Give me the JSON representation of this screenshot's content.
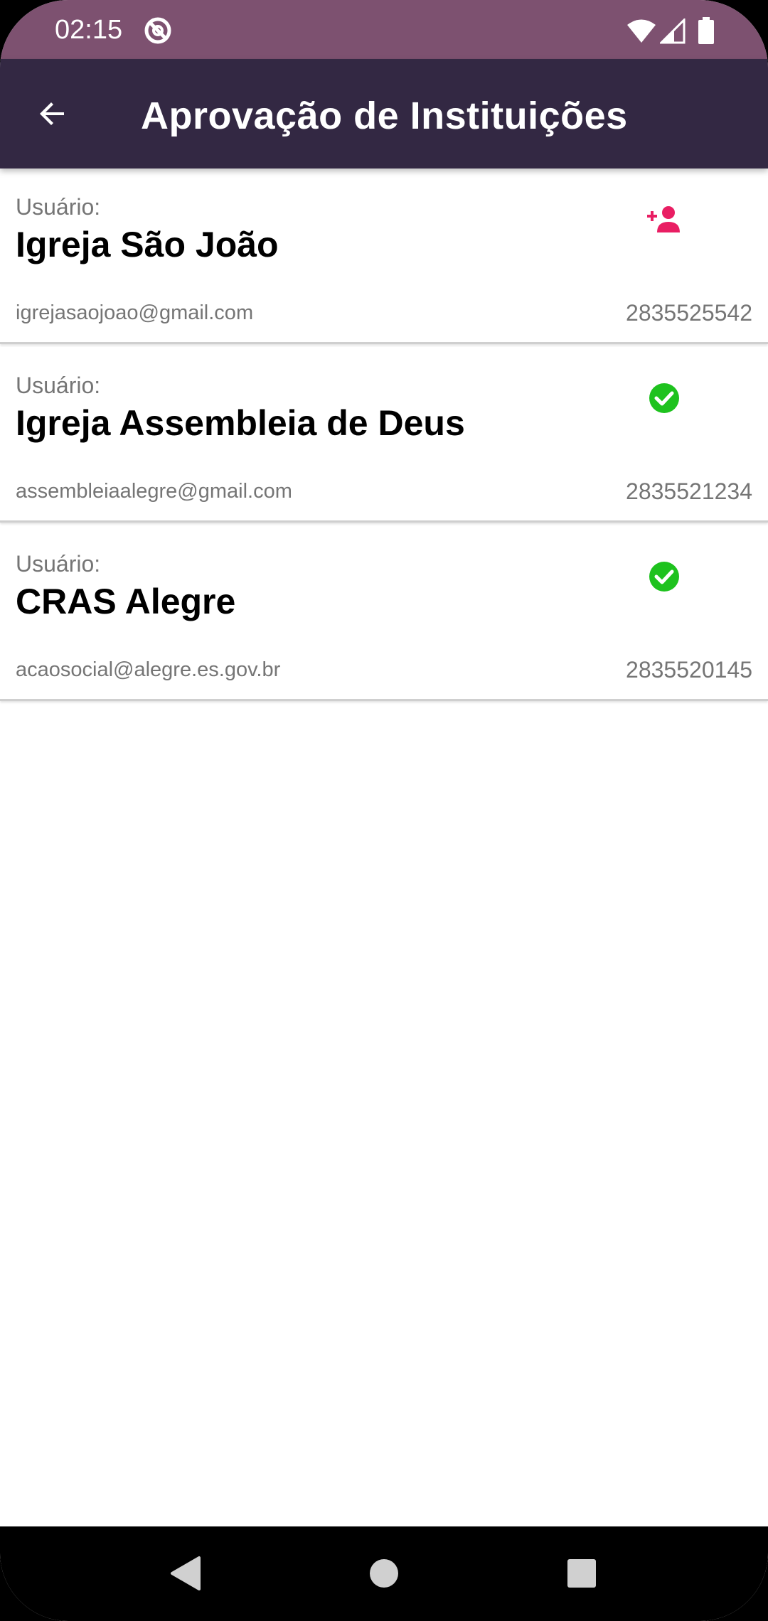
{
  "status_bar": {
    "time": "02:15",
    "icons": [
      "app-notification-icon",
      "wifi-icon",
      "signal-icon",
      "battery-icon"
    ]
  },
  "app_bar": {
    "title": "Aprovação de Instituições",
    "back_icon": "arrow-back-icon"
  },
  "institutions": [
    {
      "label": "Usuário:",
      "name": "Igreja São João",
      "email": "igrejasaojoao@gmail.com",
      "phone": "2835525542",
      "action_icon": "person-add-icon",
      "action_color": "#e91e63"
    },
    {
      "label": "Usuário:",
      "name": "Igreja Assembleia de Deus",
      "email": "assembleiaalegre@gmail.com",
      "phone": "2835521234",
      "action_icon": "check-circle-icon",
      "action_color": "#1ec21e"
    },
    {
      "label": "Usuário:",
      "name": "CRAS Alegre",
      "email": "acaosocial@alegre.es.gov.br",
      "phone": "2835520145",
      "action_icon": "check-circle-icon",
      "action_color": "#1ec21e"
    }
  ],
  "nav_bar": {
    "icons": [
      "nav-back-icon",
      "nav-home-icon",
      "nav-recents-icon"
    ]
  },
  "colors": {
    "status_bar": "#7d5170",
    "app_bar": "#332843",
    "pending_accent": "#e91e63",
    "approved_accent": "#1ec21e"
  }
}
